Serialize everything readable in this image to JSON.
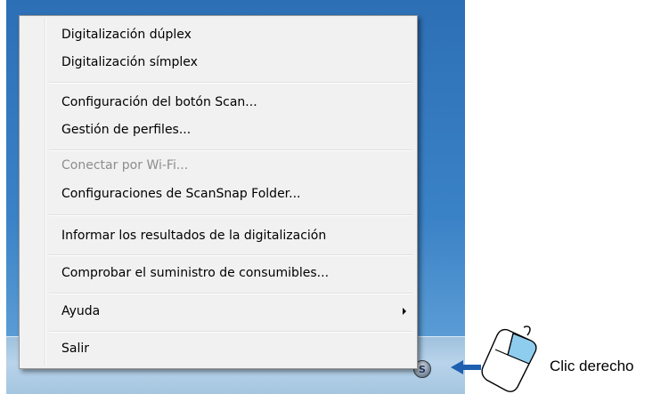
{
  "context_menu": {
    "items": [
      {
        "label": "Digitalización dúplex",
        "enabled": true
      },
      {
        "label": "Digitalización símplex",
        "enabled": true
      },
      {
        "label": "Configuración del botón Scan...",
        "enabled": true
      },
      {
        "label": "Gestión de perfiles...",
        "enabled": true
      },
      {
        "label": "Conectar por Wi-Fi...",
        "enabled": false
      },
      {
        "label": "Configuraciones de ScanSnap Folder...",
        "enabled": true
      },
      {
        "label": "Informar los resultados de la digitalización",
        "enabled": true
      },
      {
        "label": "Comprobar el suministro de consumibles...",
        "enabled": true
      },
      {
        "label": "Ayuda",
        "enabled": true,
        "has_submenu": true
      },
      {
        "label": "Salir",
        "enabled": true
      }
    ]
  },
  "taskbar": {
    "tray_icon": {
      "name": "scansnap-manager-icon",
      "glyph": "S"
    }
  },
  "callout": {
    "label": "Clic derecho",
    "icon": "mouse-right-click-icon",
    "arrow": "arrow-left-icon",
    "arrow_color": "#1f5fb0",
    "highlight_color": "#8ecdee"
  }
}
